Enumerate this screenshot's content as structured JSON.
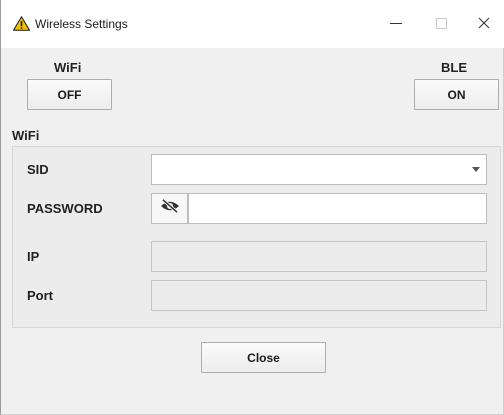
{
  "window": {
    "title": "Wireless Settings",
    "controls": {
      "minimize_icon": "minimize-icon",
      "maximize_icon": "maximize-icon",
      "close_icon": "close-icon"
    }
  },
  "toggles": {
    "wifi": {
      "label": "WiFi",
      "state": "OFF"
    },
    "ble": {
      "label": "BLE",
      "state": "ON"
    }
  },
  "wifi_section": {
    "label": "WiFi",
    "sid": {
      "label": "SID",
      "value": ""
    },
    "password": {
      "label": "PASSWORD",
      "value": "",
      "toggle_icon": "eye-slash-icon"
    },
    "ip": {
      "label": "IP",
      "value": ""
    },
    "port": {
      "label": "Port",
      "value": ""
    }
  },
  "footer": {
    "close_label": "Close"
  },
  "colors": {
    "window_bg": "#f0f0f0",
    "titlebar_bg": "#ffffff",
    "warning_icon": "#f2c200",
    "border": "#adadad"
  }
}
